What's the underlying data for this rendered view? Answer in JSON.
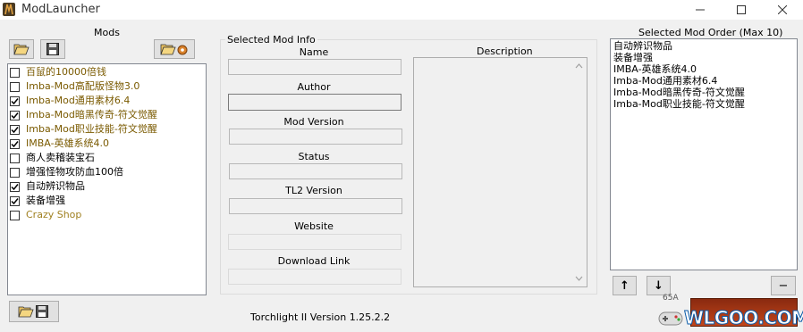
{
  "window": {
    "title": "ModLauncher"
  },
  "mods_panel": {
    "title": "Mods",
    "items": [
      {
        "label": "百鼠的10000倍钱",
        "checked": false,
        "color": "#7a5a00"
      },
      {
        "label": "Imba-Mod高配版怪物3.0",
        "checked": false,
        "color": "#7a5a00"
      },
      {
        "label": "Imba-Mod通用素材6.4",
        "checked": true,
        "color": "#7a5a00"
      },
      {
        "label": "Imba-Mod暗黑传奇-符文觉醒",
        "checked": true,
        "color": "#7a5a00"
      },
      {
        "label": "Imba-Mod职业技能-符文觉醒",
        "checked": true,
        "color": "#7a5a00"
      },
      {
        "label": "IMBA-英雄系统4.0",
        "checked": true,
        "color": "#7a5a00"
      },
      {
        "label": "商人卖稽装宝石",
        "checked": false,
        "color": "#000000"
      },
      {
        "label": "增强怪物攻防血100倍",
        "checked": false,
        "color": "#000000"
      },
      {
        "label": "自动辨识物品",
        "checked": true,
        "color": "#000000"
      },
      {
        "label": "装备增强",
        "checked": true,
        "color": "#000000"
      },
      {
        "label": "Crazy Shop",
        "checked": false,
        "color": "#a08020"
      }
    ]
  },
  "info_panel": {
    "title": "Selected Mod Info",
    "name_label": "Name",
    "author_label": "Author",
    "mod_version_label": "Mod Version",
    "status_label": "Status",
    "tl2_version_label": "TL2 Version",
    "website_label": "Website",
    "download_link_label": "Download Link",
    "description_label": "Description"
  },
  "order_panel": {
    "title": "Selected Mod Order (Max 10)",
    "items": [
      "自动辨识物品",
      "装备增强",
      "IMBA-英雄系统4.0",
      "Imba-Mod通用素材6.4",
      "Imba-Mod暗黑传奇-符文觉醒",
      "Imba-Mod职业技能-符文觉醒"
    ],
    "move_up": "↑",
    "move_down": "↓",
    "remove": "−"
  },
  "footer": {
    "version_text": "Torchlight II Version 1.25.2.2",
    "watermark_text": "WLGOO.COM",
    "watermark_small": "65A"
  },
  "icons": {
    "open": "folder-open-icon",
    "save": "floppy-disk-icon",
    "settings": "folder-gear-icon",
    "footer": "folder-save-icon"
  }
}
